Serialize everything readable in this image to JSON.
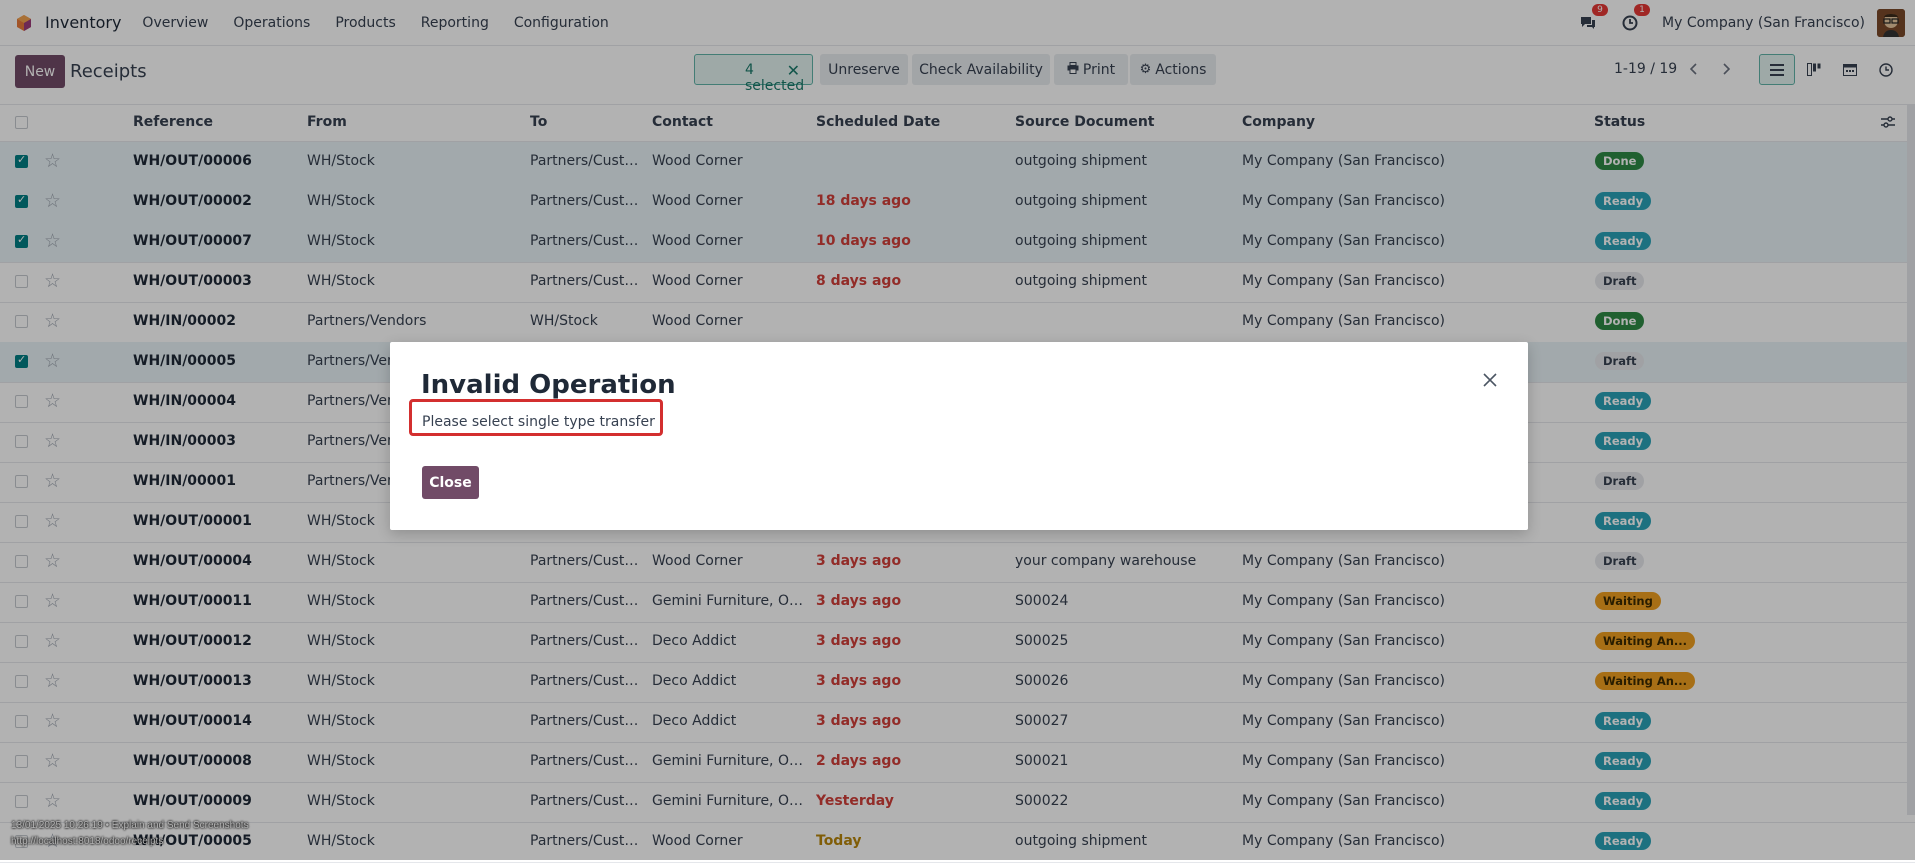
{
  "navbar": {
    "app_name": "Inventory",
    "menu": [
      "Overview",
      "Operations",
      "Products",
      "Reporting",
      "Configuration"
    ],
    "messages_badge": "9",
    "activities_badge": "1",
    "company": "My Company (San Francisco)"
  },
  "controlbar": {
    "new_label": "New",
    "title": "Receipts",
    "selected_label": "4 selected",
    "unreserve_label": "Unreserve",
    "check_availability_label": "Check Availability",
    "print_label": "Print",
    "actions_label": "Actions",
    "pager": "1-19 / 19"
  },
  "table": {
    "headers": [
      "Reference",
      "From",
      "To",
      "Contact",
      "Scheduled Date",
      "Source Document",
      "Company",
      "Status"
    ],
    "rows": [
      {
        "selected": true,
        "ref": "WH/OUT/00006",
        "from": "WH/Stock",
        "to": "Partners/Custo...",
        "contact": "Wood Corner",
        "date": "",
        "date_style": "",
        "source": "outgoing shipment",
        "company": "My Company (San Francisco)",
        "status": "Done",
        "status_kind": "done"
      },
      {
        "selected": true,
        "ref": "WH/OUT/00002",
        "from": "WH/Stock",
        "to": "Partners/Custo...",
        "contact": "Wood Corner",
        "date": "18 days ago",
        "date_style": "red",
        "source": "outgoing shipment",
        "company": "My Company (San Francisco)",
        "status": "Ready",
        "status_kind": "ready"
      },
      {
        "selected": true,
        "ref": "WH/OUT/00007",
        "from": "WH/Stock",
        "to": "Partners/Custo...",
        "contact": "Wood Corner",
        "date": "10 days ago",
        "date_style": "red",
        "source": "outgoing shipment",
        "company": "My Company (San Francisco)",
        "status": "Ready",
        "status_kind": "ready"
      },
      {
        "selected": false,
        "ref": "WH/OUT/00003",
        "from": "WH/Stock",
        "to": "Partners/Custo...",
        "contact": "Wood Corner",
        "date": "8 days ago",
        "date_style": "red",
        "source": "outgoing shipment",
        "company": "My Company (San Francisco)",
        "status": "Draft",
        "status_kind": "draft"
      },
      {
        "selected": false,
        "ref": "WH/IN/00002",
        "from": "Partners/Vendors",
        "to": "WH/Stock",
        "contact": "Wood Corner",
        "date": "",
        "date_style": "",
        "source": "",
        "company": "My Company (San Francisco)",
        "status": "Done",
        "status_kind": "done"
      },
      {
        "selected": true,
        "ref": "WH/IN/00005",
        "from": "Partners/Ven",
        "to": "",
        "contact": "",
        "date": "",
        "date_style": "",
        "source": "",
        "company": "",
        "status": "Draft",
        "status_kind": "draft"
      },
      {
        "selected": false,
        "ref": "WH/IN/00004",
        "from": "Partners/Ven",
        "to": "",
        "contact": "",
        "date": "",
        "date_style": "",
        "source": "",
        "company": "",
        "status": "Ready",
        "status_kind": "ready"
      },
      {
        "selected": false,
        "ref": "WH/IN/00003",
        "from": "Partners/Ven",
        "to": "",
        "contact": "",
        "date": "",
        "date_style": "",
        "source": "",
        "company": "",
        "status": "Ready",
        "status_kind": "ready"
      },
      {
        "selected": false,
        "ref": "WH/IN/00001",
        "from": "Partners/Ven",
        "to": "",
        "contact": "",
        "date": "",
        "date_style": "",
        "source": "",
        "company": "",
        "status": "Draft",
        "status_kind": "draft"
      },
      {
        "selected": false,
        "ref": "WH/OUT/00001",
        "from": "WH/Stock",
        "to": "",
        "contact": "",
        "date": "",
        "date_style": "",
        "source": "",
        "company": "",
        "status": "Ready",
        "status_kind": "ready"
      },
      {
        "selected": false,
        "ref": "WH/OUT/00004",
        "from": "WH/Stock",
        "to": "Partners/Custo...",
        "contact": "Wood Corner",
        "date": "3 days ago",
        "date_style": "red",
        "source": "your company warehouse",
        "company": "My Company (San Francisco)",
        "status": "Draft",
        "status_kind": "draft"
      },
      {
        "selected": false,
        "ref": "WH/OUT/00011",
        "from": "WH/Stock",
        "to": "Partners/Custo...",
        "contact": "Gemini Furniture, Osc...",
        "date": "3 days ago",
        "date_style": "red",
        "source": "S00024",
        "company": "My Company (San Francisco)",
        "status": "Waiting",
        "status_kind": "waiting"
      },
      {
        "selected": false,
        "ref": "WH/OUT/00012",
        "from": "WH/Stock",
        "to": "Partners/Custo...",
        "contact": "Deco Addict",
        "date": "3 days ago",
        "date_style": "red",
        "source": "S00025",
        "company": "My Company (San Francisco)",
        "status": "Waiting An...",
        "status_kind": "waiting"
      },
      {
        "selected": false,
        "ref": "WH/OUT/00013",
        "from": "WH/Stock",
        "to": "Partners/Custo...",
        "contact": "Deco Addict",
        "date": "3 days ago",
        "date_style": "red",
        "source": "S00026",
        "company": "My Company (San Francisco)",
        "status": "Waiting An...",
        "status_kind": "waiting"
      },
      {
        "selected": false,
        "ref": "WH/OUT/00014",
        "from": "WH/Stock",
        "to": "Partners/Custo...",
        "contact": "Deco Addict",
        "date": "3 days ago",
        "date_style": "red",
        "source": "S00027",
        "company": "My Company (San Francisco)",
        "status": "Ready",
        "status_kind": "ready"
      },
      {
        "selected": false,
        "ref": "WH/OUT/00008",
        "from": "WH/Stock",
        "to": "Partners/Custo...",
        "contact": "Gemini Furniture, Osc...",
        "date": "2 days ago",
        "date_style": "red",
        "source": "S00021",
        "company": "My Company (San Francisco)",
        "status": "Ready",
        "status_kind": "ready"
      },
      {
        "selected": false,
        "ref": "WH/OUT/00009",
        "from": "WH/Stock",
        "to": "Partners/Custo...",
        "contact": "Gemini Furniture, Osc...",
        "date": "Yesterday",
        "date_style": "red",
        "source": "S00022",
        "company": "My Company (San Francisco)",
        "status": "Ready",
        "status_kind": "ready"
      },
      {
        "selected": false,
        "ref": "WH/OUT/00005",
        "from": "WH/Stock",
        "to": "Partners/Custo...",
        "contact": "Wood Corner",
        "date": "Today",
        "date_style": "yellow",
        "source": "outgoing shipment",
        "company": "My Company (San Francisco)",
        "status": "Ready",
        "status_kind": "ready"
      }
    ]
  },
  "dialog": {
    "title": "Invalid Operation",
    "message": "Please select single type transfer",
    "close_label": "Close"
  },
  "footer": {
    "line1": "13/01/2025 10:26:19 • Explain and Send Screenshots",
    "line2": "http://localhost:8018/odoo/receipts"
  },
  "colors": {
    "brand": "#714b67",
    "teal": "#017e84",
    "highlight": "#d32f2f"
  }
}
